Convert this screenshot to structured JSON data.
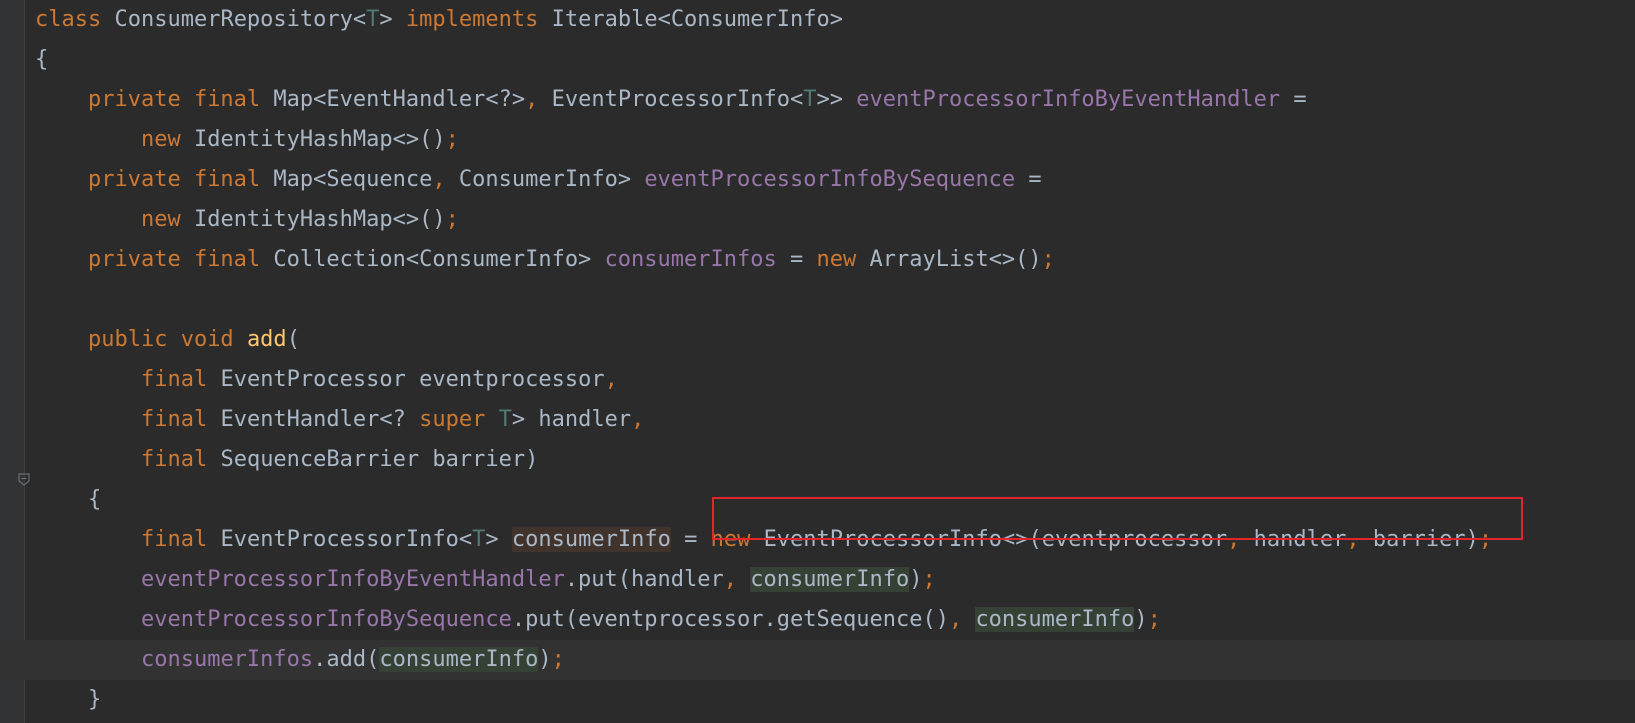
{
  "editor": {
    "lines": [
      [
        {
          "t": "class ",
          "c": "kw"
        },
        {
          "t": "ConsumerRepository<"
        },
        {
          "t": "T",
          "c": "tp"
        },
        {
          "t": "> "
        },
        {
          "t": "implements ",
          "c": "kw"
        },
        {
          "t": "Iterable<ConsumerInfo>"
        }
      ],
      [
        {
          "t": "{"
        }
      ],
      [
        {
          "t": "    "
        },
        {
          "t": "private final ",
          "c": "kw"
        },
        {
          "t": "Map<EventHandler<?>"
        },
        {
          "t": ", ",
          "c": "pn"
        },
        {
          "t": "EventProcessorInfo<"
        },
        {
          "t": "T",
          "c": "tp"
        },
        {
          "t": ">> "
        },
        {
          "t": "eventProcessorInfoByEventHandler",
          "c": "fld"
        },
        {
          "t": " ="
        }
      ],
      [
        {
          "t": "        "
        },
        {
          "t": "new ",
          "c": "kw"
        },
        {
          "t": "IdentityHashMap<>()"
        },
        {
          "t": ";",
          "c": "pn"
        }
      ],
      [
        {
          "t": "    "
        },
        {
          "t": "private final ",
          "c": "kw"
        },
        {
          "t": "Map<Sequence"
        },
        {
          "t": ", ",
          "c": "pn"
        },
        {
          "t": "ConsumerInfo> "
        },
        {
          "t": "eventProcessorInfoBySequence",
          "c": "fld"
        },
        {
          "t": " ="
        }
      ],
      [
        {
          "t": "        "
        },
        {
          "t": "new ",
          "c": "kw"
        },
        {
          "t": "IdentityHashMap<>()"
        },
        {
          "t": ";",
          "c": "pn"
        }
      ],
      [
        {
          "t": "    "
        },
        {
          "t": "private final ",
          "c": "kw"
        },
        {
          "t": "Collection<ConsumerInfo> "
        },
        {
          "t": "consumerInfos",
          "c": "fld"
        },
        {
          "t": " = "
        },
        {
          "t": "new ",
          "c": "kw"
        },
        {
          "t": "ArrayList<>()"
        },
        {
          "t": ";",
          "c": "pn"
        }
      ],
      [
        {
          "t": ""
        }
      ],
      [
        {
          "t": "    "
        },
        {
          "t": "public void ",
          "c": "kw"
        },
        {
          "t": "add",
          "c": "fn"
        },
        {
          "t": "("
        }
      ],
      [
        {
          "t": "        "
        },
        {
          "t": "final ",
          "c": "kw"
        },
        {
          "t": "EventProcessor eventprocessor"
        },
        {
          "t": ",",
          "c": "pn"
        }
      ],
      [
        {
          "t": "        "
        },
        {
          "t": "final ",
          "c": "kw"
        },
        {
          "t": "EventHandler<? "
        },
        {
          "t": "super ",
          "c": "kw"
        },
        {
          "t": "T",
          "c": "tp"
        },
        {
          "t": "> handler"
        },
        {
          "t": ",",
          "c": "pn"
        }
      ],
      [
        {
          "t": "        "
        },
        {
          "t": "final ",
          "c": "kw"
        },
        {
          "t": "SequenceBarrier barrier)"
        }
      ],
      [
        {
          "t": "    {"
        }
      ],
      [
        {
          "t": "        "
        },
        {
          "t": "final ",
          "c": "kw"
        },
        {
          "t": "EventProcessorInfo<"
        },
        {
          "t": "T",
          "c": "tp"
        },
        {
          "t": "> "
        },
        {
          "t": "consumerInfo",
          "c": "hl-decl-write"
        },
        {
          "t": " = "
        },
        {
          "t": "new ",
          "c": "kw"
        },
        {
          "t": "EventProcessorInfo<>(eventprocessor"
        },
        {
          "t": ", ",
          "c": "pn"
        },
        {
          "t": "handler"
        },
        {
          "t": ", ",
          "c": "pn"
        },
        {
          "t": "barrier)"
        },
        {
          "t": ";",
          "c": "pn"
        }
      ],
      [
        {
          "t": "        "
        },
        {
          "t": "eventProcessorInfoByEventHandler",
          "c": "fld"
        },
        {
          "t": ".put(handler"
        },
        {
          "t": ", ",
          "c": "pn"
        },
        {
          "t": "consumerInfo",
          "c": "hl-use"
        },
        {
          "t": ")"
        },
        {
          "t": ";",
          "c": "pn"
        }
      ],
      [
        {
          "t": "        "
        },
        {
          "t": "eventProcessorInfoBySequence",
          "c": "fld"
        },
        {
          "t": ".put(eventprocessor.getSequence()"
        },
        {
          "t": ", ",
          "c": "pn"
        },
        {
          "t": "consumerInfo",
          "c": "hl-use"
        },
        {
          "t": ")"
        },
        {
          "t": ";",
          "c": "pn"
        }
      ],
      [
        {
          "t": "        "
        },
        {
          "t": "consumerInfos",
          "c": "fld"
        },
        {
          "t": ".add("
        },
        {
          "t": "consumerInfo",
          "c": "hl-use"
        },
        {
          "t": ")"
        },
        {
          "t": ";",
          "c": "pn"
        }
      ],
      [
        {
          "t": "    }"
        }
      ]
    ],
    "caret_line_index": 16
  },
  "colors": {
    "background": "#2b2b2b",
    "keyword": "#cc7832",
    "type_param": "#507874",
    "field": "#9876aa",
    "method": "#ffc66d",
    "text": "#a9b7c6",
    "highlight_box": "#e0262b"
  },
  "icons": {
    "fold_open": "fold-open-icon",
    "fold_close": "fold-close-icon"
  }
}
